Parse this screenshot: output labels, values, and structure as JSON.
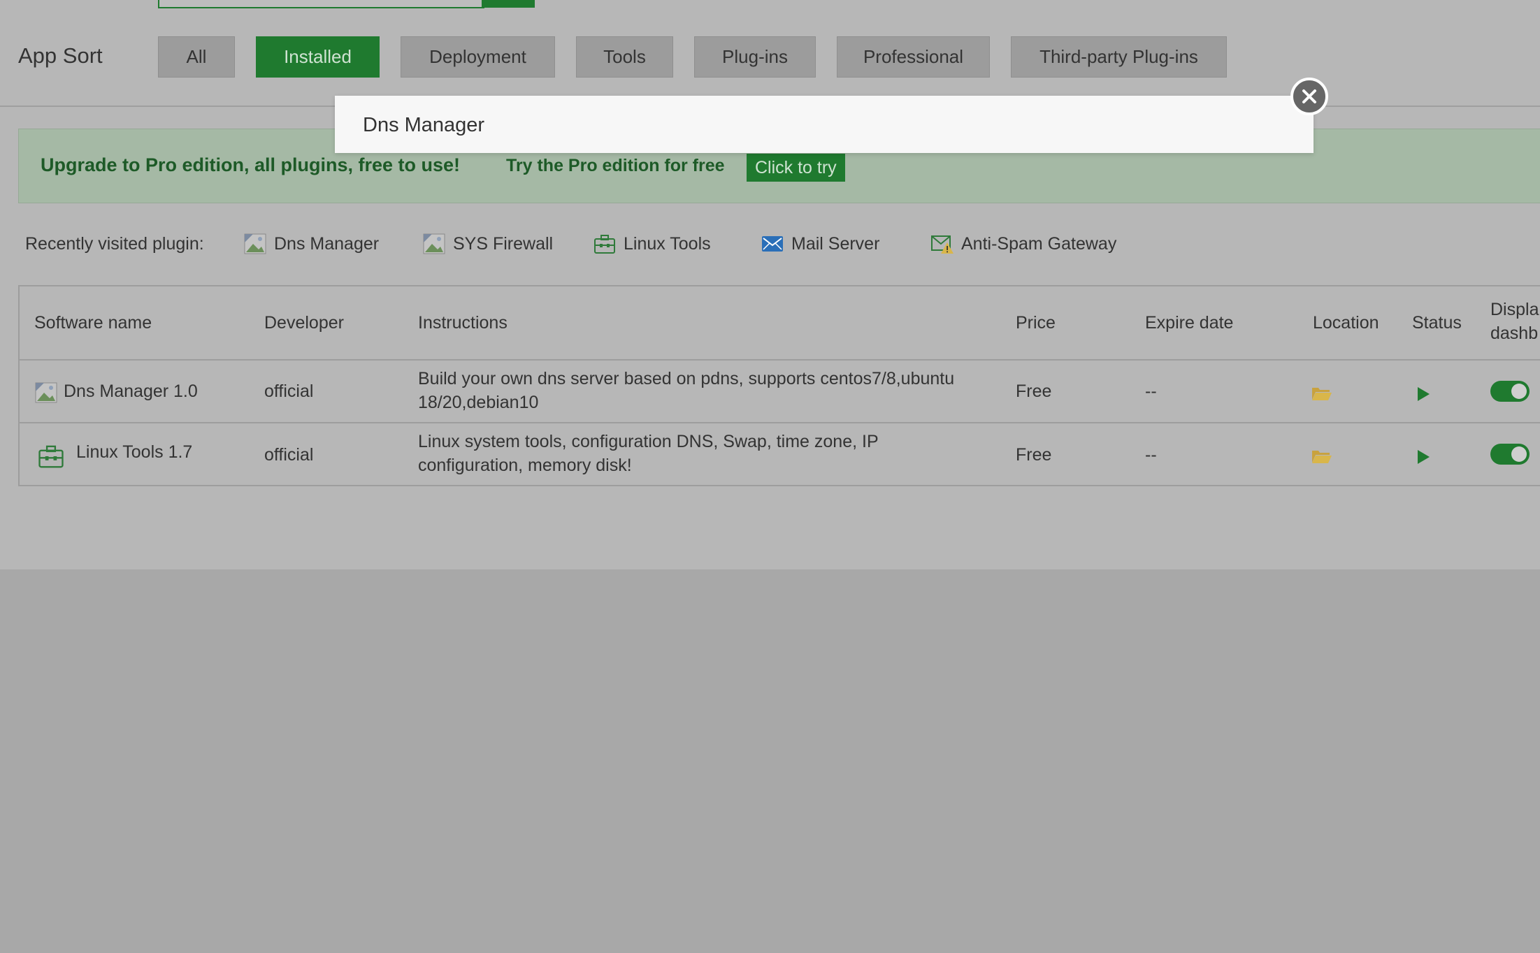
{
  "sort": {
    "label": "App Sort",
    "tabs": [
      {
        "label": "All",
        "active": false
      },
      {
        "label": "Installed",
        "active": true
      },
      {
        "label": "Deployment",
        "active": false
      },
      {
        "label": "Tools",
        "active": false
      },
      {
        "label": "Plug-ins",
        "active": false
      },
      {
        "label": "Professional",
        "active": false
      },
      {
        "label": "Third-party Plug-ins",
        "active": false
      }
    ]
  },
  "banner": {
    "title": "Upgrade to Pro edition, all plugins, free to use!",
    "try_text": "Try the Pro edition for free",
    "button": "Click to try"
  },
  "recent": {
    "label": "Recently visited plugin:",
    "items": [
      {
        "label": "Dns Manager",
        "icon": "broken-image-icon"
      },
      {
        "label": "SYS Firewall",
        "icon": "broken-image-icon"
      },
      {
        "label": "Linux Tools",
        "icon": "toolbox-icon"
      },
      {
        "label": "Mail Server",
        "icon": "mail-icon"
      },
      {
        "label": "Anti-Spam Gateway",
        "icon": "mail-warning-icon"
      }
    ]
  },
  "table": {
    "headers": {
      "name": "Software name",
      "developer": "Developer",
      "instructions": "Instructions",
      "price": "Price",
      "expire": "Expire date",
      "location": "Location",
      "status": "Status",
      "display_line1": "Displa",
      "display_line2": "dashb"
    },
    "rows": [
      {
        "name": "Dns Manager 1.0",
        "developer": "official",
        "instructions_line1": "Build your own dns server based on pdns, supports centos7/8,ubuntu",
        "instructions_line2": "18/20,debian10",
        "price": "Free",
        "expire": "--",
        "icon": "broken-image-icon"
      },
      {
        "name": "Linux Tools 1.7",
        "developer": "official",
        "instructions_line1": "Linux system tools, configuration DNS, Swap, time zone, IP",
        "instructions_line2": "configuration, memory disk!",
        "price": "Free",
        "expire": "--",
        "icon": "toolbox-icon"
      }
    ]
  },
  "modal": {
    "title": "Dns Manager"
  },
  "colors": {
    "accent": "#1f7a2f",
    "folder": "#d9b64a"
  }
}
